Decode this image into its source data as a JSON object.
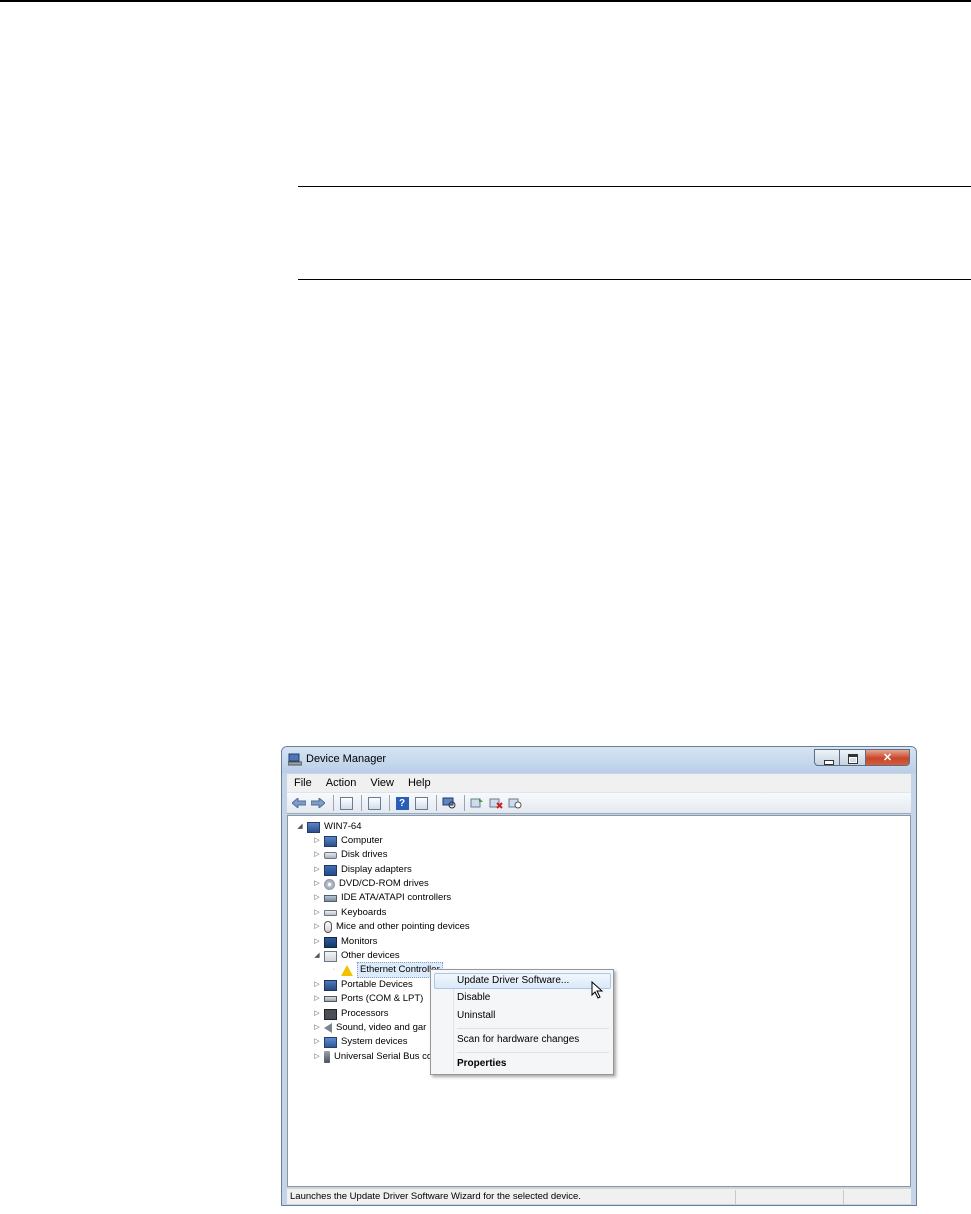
{
  "window": {
    "title": "Device Manager"
  },
  "menu": [
    "File",
    "Action",
    "View",
    "Help"
  ],
  "toolbar": {
    "icons": [
      "back-arrow-icon",
      "forward-arrow-icon",
      "show-hide-console-tree-icon",
      "properties-icon",
      "help-icon",
      "action-pane-icon",
      "scan-hardware-icon",
      "update-driver-icon",
      "uninstall-icon",
      "disable-icon"
    ]
  },
  "tree": {
    "root": "WIN7-64",
    "items": [
      {
        "label": "Computer",
        "icon": "computer-icon"
      },
      {
        "label": "Disk drives",
        "icon": "disk-drive-icon"
      },
      {
        "label": "Display adapters",
        "icon": "display-adapter-icon"
      },
      {
        "label": "DVD/CD-ROM drives",
        "icon": "dvd-drive-icon"
      },
      {
        "label": "IDE ATA/ATAPI controllers",
        "icon": "ide-controller-icon"
      },
      {
        "label": "Keyboards",
        "icon": "keyboard-icon"
      },
      {
        "label": "Mice and other pointing devices",
        "icon": "mouse-icon"
      },
      {
        "label": "Monitors",
        "icon": "monitor-icon"
      },
      {
        "label": "Other devices",
        "icon": "other-devices-icon"
      },
      {
        "label": "Ethernet Controller",
        "icon": "warning-icon"
      },
      {
        "label": "Portable Devices",
        "icon": "portable-device-icon"
      },
      {
        "label": "Ports (COM & LPT)",
        "icon": "port-icon"
      },
      {
        "label": "Processors",
        "icon": "processor-icon"
      },
      {
        "label": "Sound, video and gar",
        "icon": "sound-icon"
      },
      {
        "label": "System devices",
        "icon": "system-device-icon"
      },
      {
        "label": "Universal Serial Bus co",
        "icon": "usb-icon"
      }
    ]
  },
  "context_menu": {
    "update_driver": "Update Driver Software...",
    "disable": "Disable",
    "uninstall": "Uninstall",
    "scan": "Scan for hardware changes",
    "properties": "Properties"
  },
  "status": {
    "text": "Launches the Update Driver Software Wizard for the selected device."
  }
}
